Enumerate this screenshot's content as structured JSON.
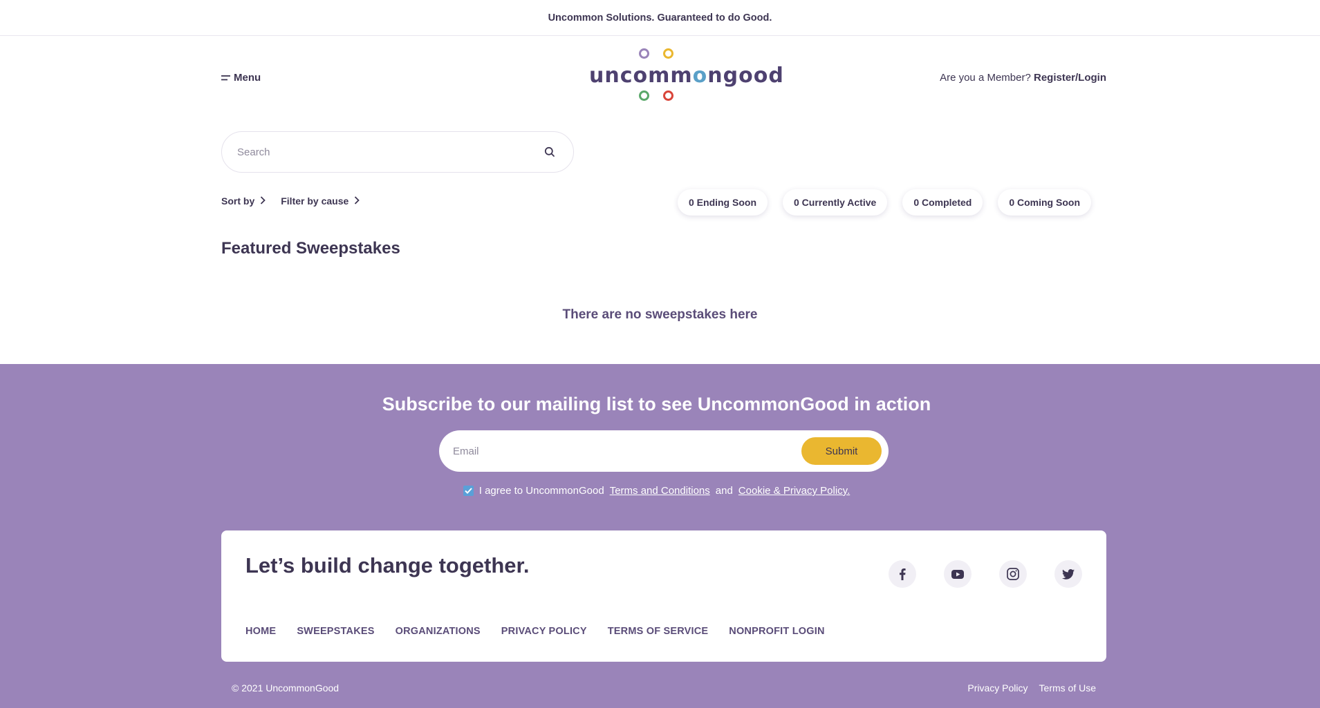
{
  "topbar": {
    "tagline": "Uncommon Solutions. Guaranteed to do Good."
  },
  "header": {
    "menu_label": "Menu",
    "logo_text_pre": "uncomm",
    "logo_text_accent": "o",
    "logo_text_post": "ngood",
    "logo_colors": [
      "#9a84b9",
      "#eab730",
      "#5aa86a",
      "#d9453a"
    ],
    "member_prompt": "Are you a Member?",
    "member_link": "Register/Login"
  },
  "search": {
    "placeholder": "Search"
  },
  "filters": {
    "sort_label": "Sort by",
    "cause_label": "Filter by cause"
  },
  "status_pills": [
    {
      "label": "0 Ending Soon"
    },
    {
      "label": "0 Currently Active"
    },
    {
      "label": "0 Completed"
    },
    {
      "label": "0 Coming Soon"
    }
  ],
  "featured": {
    "title": "Featured Sweepstakes",
    "empty_message": "There are no sweepstakes here"
  },
  "subscribe": {
    "title": "Subscribe to our mailing list to see UncommonGood in action",
    "email_placeholder": "Email",
    "submit_label": "Submit",
    "agree_prefix": "I agree to UncommonGood",
    "terms_link": "Terms and Conditions",
    "agree_and": "and",
    "privacy_link": "Cookie & Privacy Policy."
  },
  "card": {
    "title": "Let’s build change together.",
    "nav": [
      "HOME",
      "SWEEPSTAKES",
      "ORGANIZATIONS",
      "PRIVACY POLICY",
      "TERMS OF SERVICE",
      "NONPROFIT LOGIN"
    ],
    "social": [
      "facebook-icon",
      "youtube-icon",
      "instagram-icon",
      "twitter-icon"
    ]
  },
  "bottom": {
    "copyright": "© 2021 UncommonGood",
    "privacy": "Privacy Policy",
    "terms": "Terms of Use"
  },
  "colors": {
    "brand_purple": "#9a84b9",
    "text_dark": "#3d3552",
    "accent_yellow": "#eab730",
    "checkbox_blue": "#5aa0d8"
  }
}
